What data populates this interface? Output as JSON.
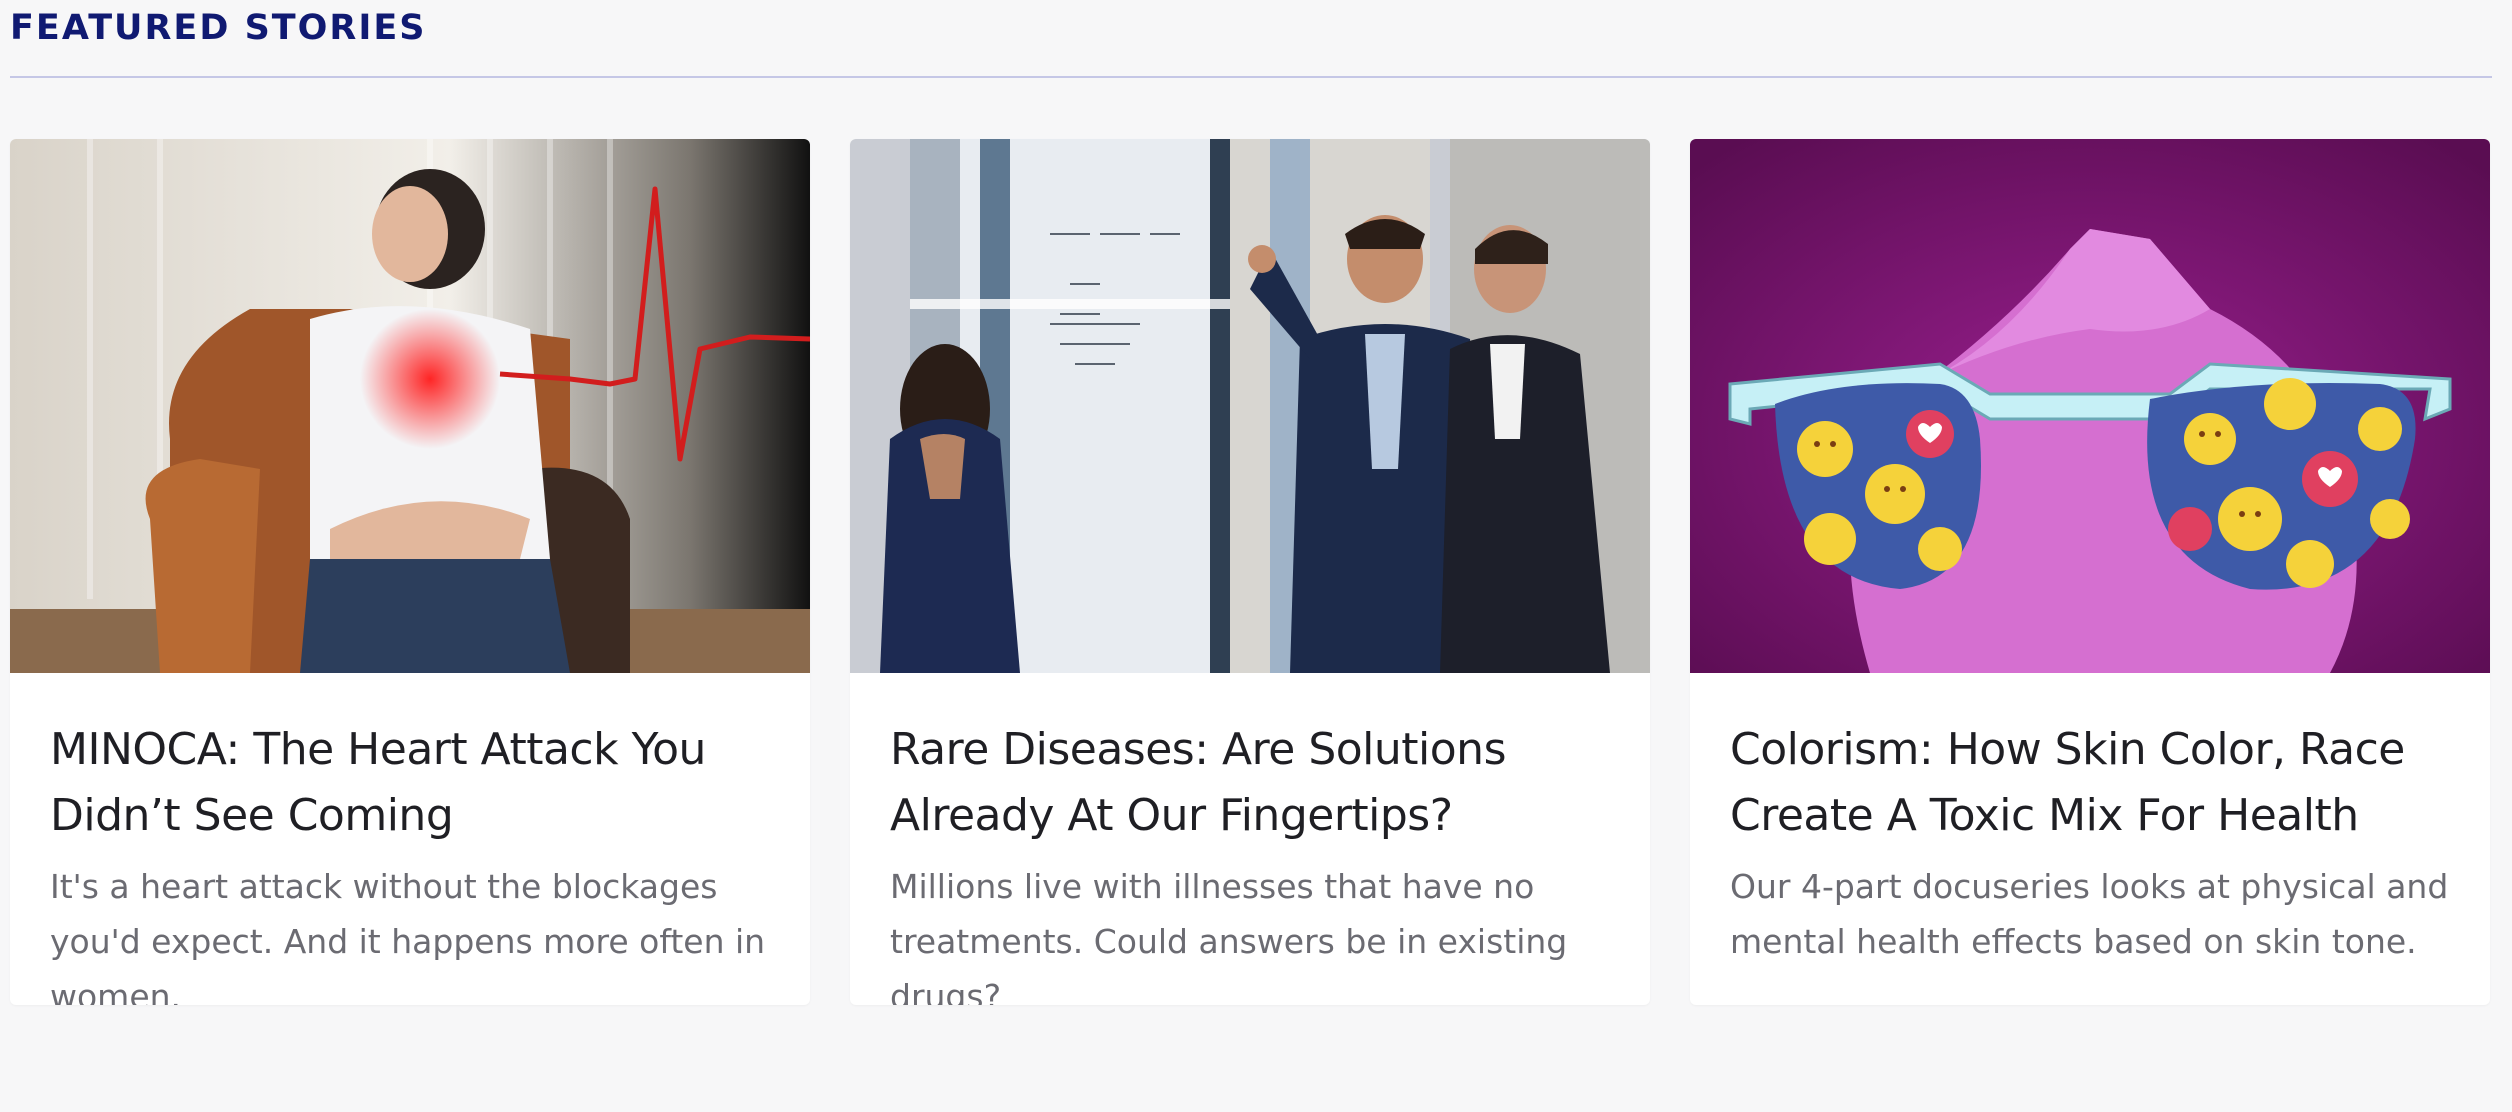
{
  "section": {
    "title": "FEATURED STORIES"
  },
  "cards": [
    {
      "title": "MINOCA: The Heart Attack You Didn’t See Coming",
      "description": "It's a heart attack without the blockages you'd expect. And it happens more often in women.",
      "image_alt": "woman clutching chest with heartbeat line"
    },
    {
      "title": "Rare Diseases: Are Solutions Already At Our Fingertips?",
      "description": "Millions live with illnesses that have no treatments. Could answers be in existing drugs?",
      "image_alt": "three people talking at a whiteboard"
    },
    {
      "title": "Colorism: How Skin Color, Race Create A Toxic Mix For Health",
      "description": "Our 4-part docuseries looks at physical and mental health effects based on skin tone.",
      "image_alt": "sunglasses reflecting emoji faces on purple background"
    }
  ],
  "colors": {
    "heading": "#101a72",
    "divider": "#c5c7e6",
    "background": "#f7f7f8"
  }
}
